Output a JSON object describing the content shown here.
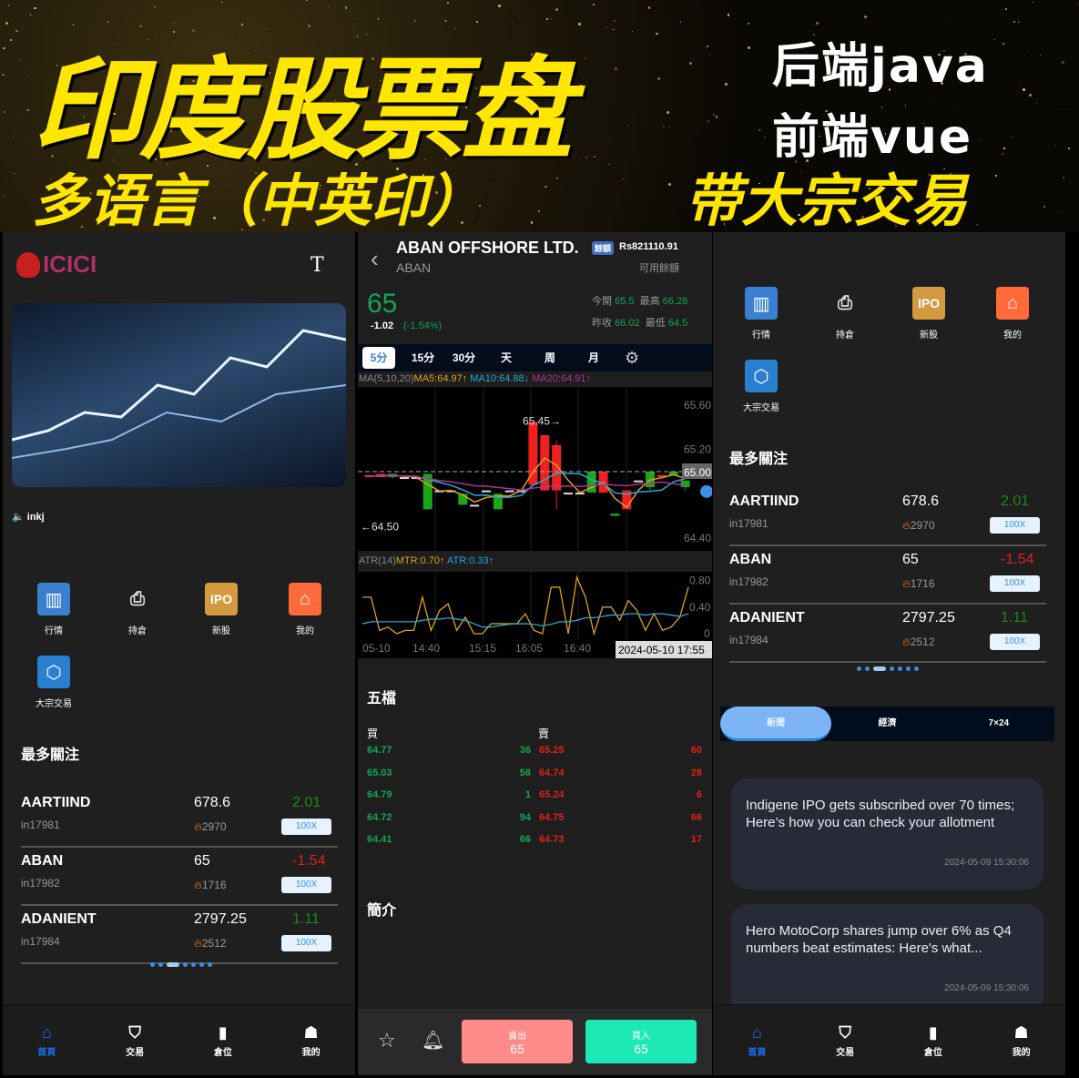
{
  "banner": {
    "title": "印度股票盘",
    "backend": "后端java",
    "frontend": "前端vue",
    "languages": "多语言（中英印）",
    "feature": "带大宗交易"
  },
  "home": {
    "logo": "ICICI",
    "font_button": "T",
    "notice": "inkj",
    "icons": [
      {
        "label": "行情",
        "icon": "chart-icon"
      },
      {
        "label": "持倉",
        "icon": "holdings-icon"
      },
      {
        "label": "新股",
        "icon": "ipo-icon",
        "glyph": "IPO"
      },
      {
        "label": "我的",
        "icon": "home-icon"
      },
      {
        "label": "大宗交易",
        "icon": "block-trade-icon"
      }
    ],
    "section_title": "最多關注",
    "stocks": [
      {
        "name": "AARTIIND",
        "code": "in17981",
        "price": "678.6",
        "heat": "2970",
        "change": "2.01",
        "dir": "up",
        "leverage": "100X"
      },
      {
        "name": "ABAN",
        "code": "in17982",
        "price": "65",
        "heat": "1716",
        "change": "-1.54",
        "dir": "down",
        "leverage": "100X"
      },
      {
        "name": "ADANIENT",
        "code": "in17984",
        "price": "2797.25",
        "heat": "2512",
        "change": "1.11",
        "dir": "up",
        "leverage": "100X"
      }
    ]
  },
  "nav": [
    {
      "label": "首頁",
      "icon": "home-icon",
      "active": true
    },
    {
      "label": "交易",
      "icon": "shield-dollar-icon"
    },
    {
      "label": "倉位",
      "icon": "bar-chart-icon"
    },
    {
      "label": "我的",
      "icon": "user-icon"
    }
  ],
  "detail": {
    "name": "ABAN OFFSHORE LTD.",
    "symbol": "ABAN",
    "balance_badge": "餘額",
    "balance": "Rs821110.91",
    "balance_label": "可用餘額",
    "price": "65",
    "change": "-1.02",
    "change_pct": "(-1.54%)",
    "open_label": "今開",
    "open": "65.5",
    "high_label": "最高",
    "high": "66.28",
    "prev_label": "昨收",
    "prev": "66.02",
    "low_label": "最低",
    "low": "64.5",
    "periods": [
      "5分",
      "15分",
      "30分",
      "天",
      "周",
      "月"
    ],
    "active_period": "5分",
    "ma_legend": {
      "label": "MA(5,10,20)",
      "ma5": "MA5:64.97↑",
      "ma10": "MA10:64.88↓",
      "ma20": "MA20:64.91↑"
    },
    "atr_legend": {
      "label": "ATR(14)",
      "mtr": "MTR:0.70↑",
      "atr": "ATR:0.33↑"
    },
    "orderbook_title": "五檔",
    "buy_label": "買",
    "sell_label": "賣",
    "bids": [
      [
        "64.77",
        "36"
      ],
      [
        "65.03",
        "58"
      ],
      [
        "64.79",
        "1"
      ],
      [
        "64.72",
        "94"
      ],
      [
        "64.41",
        "66"
      ]
    ],
    "asks": [
      [
        "65.25",
        "60"
      ],
      [
        "64.74",
        "28"
      ],
      [
        "65.24",
        "6"
      ],
      [
        "64.75",
        "66"
      ],
      [
        "64.73",
        "17"
      ]
    ],
    "intro_title": "簡介",
    "sell_button": {
      "label": "賣出",
      "price": "65"
    },
    "buy_button": {
      "label": "買入",
      "price": "65"
    }
  },
  "chart_data": [
    {
      "type": "candlestick",
      "y_ticks": [
        "65.60",
        "65.20",
        "65.00",
        "64.40"
      ],
      "ylim": [
        64.3,
        65.7
      ],
      "x_ticks": [
        "05-10",
        "14:40",
        "15:15",
        "16:05",
        "16:40"
      ],
      "crosshair_time": "2024-05-10  17:55",
      "current_price_label": "65.00",
      "max_label": "65.45→",
      "min_label": "←64.50",
      "candles": [
        [
          64.95,
          64.97,
          64.97,
          64.95
        ],
        [
          64.95,
          64.98,
          64.98,
          64.95
        ],
        [
          64.98,
          64.95,
          64.98,
          64.94
        ],
        [
          64.95,
          64.95,
          64.95,
          64.95
        ],
        [
          64.95,
          64.95,
          64.95,
          64.95
        ],
        [
          64.98,
          64.66,
          64.98,
          64.66
        ],
        [
          64.83,
          64.83,
          64.83,
          64.83
        ],
        [
          64.83,
          64.83,
          64.83,
          64.83
        ],
        [
          64.8,
          64.7,
          64.8,
          64.7
        ],
        [
          64.7,
          64.7,
          64.7,
          64.7
        ],
        [
          64.83,
          64.83,
          64.83,
          64.83
        ],
        [
          64.8,
          64.66,
          64.8,
          64.66
        ],
        [
          64.83,
          64.83,
          64.83,
          64.83
        ],
        [
          64.83,
          64.83,
          64.83,
          64.83
        ],
        [
          64.88,
          65.45,
          65.45,
          64.88
        ],
        [
          64.83,
          65.33,
          65.33,
          64.83
        ],
        [
          64.83,
          65.24,
          65.28,
          64.66
        ],
        [
          64.81,
          64.81,
          64.81,
          64.81
        ],
        [
          64.81,
          64.81,
          64.81,
          64.81
        ],
        [
          65.0,
          64.81,
          65.0,
          64.81
        ],
        [
          64.81,
          65.0,
          65.0,
          64.81
        ],
        [
          64.62,
          64.6,
          64.62,
          64.6
        ],
        [
          64.66,
          64.83,
          64.83,
          64.66
        ],
        [
          64.92,
          64.92,
          64.92,
          64.92
        ],
        [
          65.0,
          64.86,
          65.0,
          64.83
        ],
        [
          64.95,
          64.97,
          64.97,
          64.95
        ],
        [
          65.0,
          64.97,
          65.0,
          64.97
        ],
        [
          64.92,
          64.86,
          64.92,
          64.83
        ]
      ]
    },
    {
      "type": "line",
      "y_ticks": [
        "0.80",
        "0.40",
        "0"
      ],
      "ylim": [
        0,
        0.85
      ],
      "series": [
        {
          "name": "MTR",
          "color": "#e0a020",
          "values": [
            0.55,
            0.55,
            0.05,
            0.1,
            0,
            0.05,
            0.05,
            0.55,
            0.05,
            0.35,
            0.45,
            0.05,
            0.25,
            0,
            0,
            0.15,
            0.15,
            0.15,
            0.15,
            0.3,
            0.05,
            0,
            0.7,
            0.7,
            0,
            0.85,
            0.55,
            0,
            0.4,
            0.4,
            0.2,
            0.5,
            0.35,
            0.05,
            0.3,
            0.05,
            0.1,
            0.25,
            0.7
          ]
        },
        {
          "name": "ATR",
          "color": "#2aa8d8",
          "values": [
            0.15,
            0.18,
            0.18,
            0.18,
            0.18,
            0.18,
            0.18,
            0.2,
            0.22,
            0.22,
            0.24,
            0.22,
            0.2,
            0.15,
            0.1,
            0.1,
            0.12,
            0.14,
            0.15,
            0.15,
            0.14,
            0.12,
            0.14,
            0.18,
            0.18,
            0.2,
            0.24,
            0.24,
            0.26,
            0.28,
            0.28,
            0.3,
            0.3,
            0.28,
            0.3,
            0.3,
            0.28,
            0.26,
            0.3
          ]
        }
      ]
    }
  ],
  "right": {
    "tabs": [
      "新聞",
      "經濟",
      "7×24"
    ],
    "active_tab": "新聞",
    "news": [
      {
        "title": "Indigene IPO gets subscribed over 70 times; Here’s how you can check your allotment",
        "time": "2024-05-09 15:30:06"
      },
      {
        "title": "Hero MotoCorp shares jump over 6% as Q4 numbers beat estimates: Here's what...",
        "time": "2024-05-09 15:30:06"
      }
    ]
  },
  "colors": {
    "up": "#13a557",
    "down": "#e02020",
    "accent": "#3a8ee6",
    "buy": "#1de9b6",
    "sell": "#ff8a8a",
    "title_yellow": "#ffe600"
  }
}
